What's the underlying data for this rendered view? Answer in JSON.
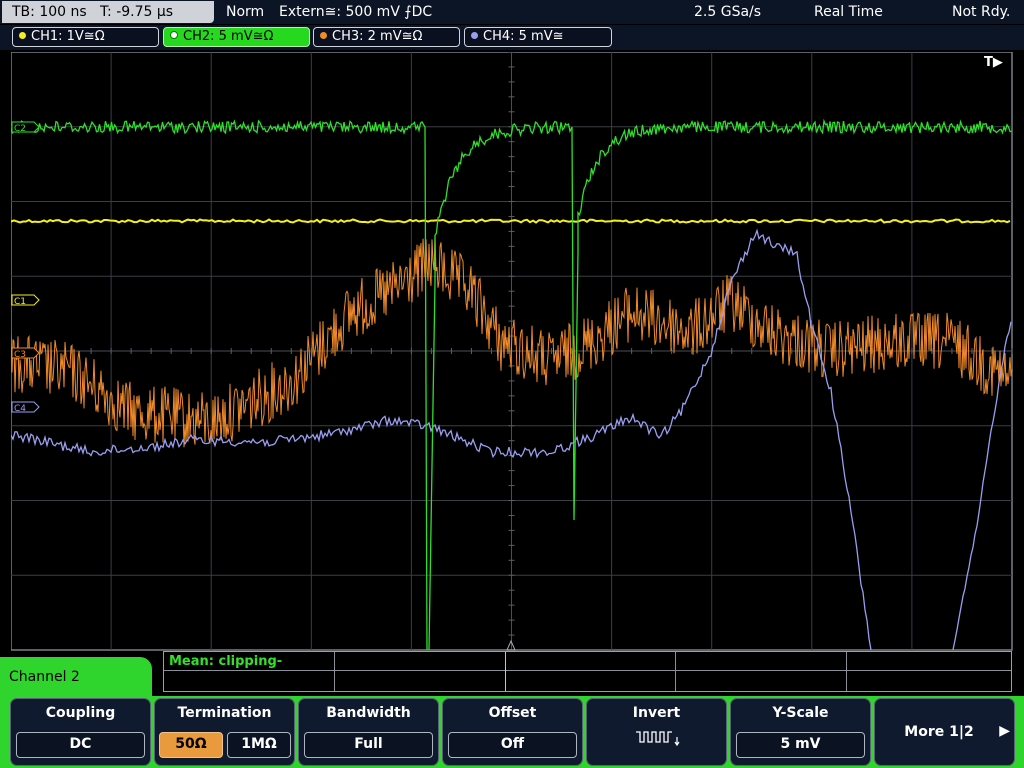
{
  "status": {
    "timebase": "TB: 100 ns",
    "trigger_time": "T: -9.75 µs",
    "mode": "Norm",
    "trigger_source": "Extern≅: 500 mV ⨍DC",
    "sample_rate": "2.5 GSa/s",
    "acq_mode": "Real Time",
    "state": "Not Rdy."
  },
  "channels": [
    {
      "label": "CH1: 1V≅Ω",
      "color": "#f5f01a",
      "marker": "C1"
    },
    {
      "label": "CH2: 5 mV≅Ω",
      "color": "#2ee02a",
      "marker": "C2",
      "active": true
    },
    {
      "label": "CH3: 2 mV≅Ω",
      "color": "#f08a2a",
      "marker": "C3"
    },
    {
      "label": "CH4: 5 mV≅",
      "color": "#9a9ef0",
      "marker": "C4"
    }
  ],
  "trigger_marker": "T▶",
  "measurement": {
    "text": "Mean: clipping-"
  },
  "menu": {
    "title": "Channel 2",
    "coupling": {
      "title": "Coupling",
      "value": "DC"
    },
    "termination": {
      "title": "Termination",
      "opt1": "50Ω",
      "opt2": "1MΩ",
      "selected": "50Ω"
    },
    "bandwidth": {
      "title": "Bandwidth",
      "value": "Full"
    },
    "offset": {
      "title": "Offset",
      "value": "Off"
    },
    "invert": {
      "title": "Invert",
      "icon": "inverted-pulse-icon"
    },
    "yscale": {
      "title": "Y-Scale",
      "value": "5 mV"
    },
    "more": {
      "label": "More 1|2",
      "icon": "right-arrow-icon"
    }
  },
  "colors": {
    "accent": "#2fd42c",
    "panel": "#101a2e",
    "selected": "#e89a3c"
  }
}
